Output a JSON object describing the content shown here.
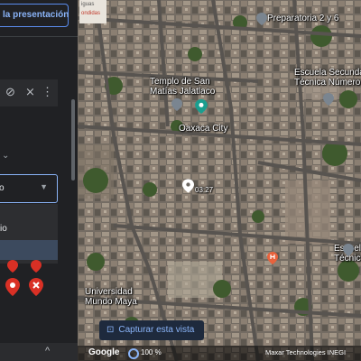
{
  "panel": {
    "presentation_button": "la presentación",
    "dropdown_value": "o",
    "menu_option": "io",
    "bottom_chevron": "^"
  },
  "map": {
    "labels": {
      "preparatoria": "Preparatoria 2 y 6",
      "escuela_secundaria": "Escuela Secundaria\nTécnica Número 1",
      "templo": "Templo de San\nMatías Jalatlaco",
      "oaxaca": "Oaxaca City",
      "coordinate": "03:27",
      "universidad": "Universidad\nMundo Maya",
      "escuela_tecnica": "Escuela\nTécnic",
      "top_sign_1": "iguas",
      "top_sign_2": "ondidas"
    },
    "capture_button": "Capturar esta vista",
    "attribution": {
      "logo": "Google",
      "zoom": "100 %",
      "credits": "Maxar Technologies  INEGI"
    }
  },
  "icons": [
    "hide-icon",
    "more-vert-icon",
    "chevron-down-icon",
    "place-pin-icon",
    "camera-icon",
    "hospital-pin-icon",
    "school-pin-icon"
  ],
  "colors": {
    "accent": "#8ab4f8",
    "panel_bg": "#202124",
    "pin_red": "#d93025",
    "pin_teal": "#1a9e8f"
  }
}
